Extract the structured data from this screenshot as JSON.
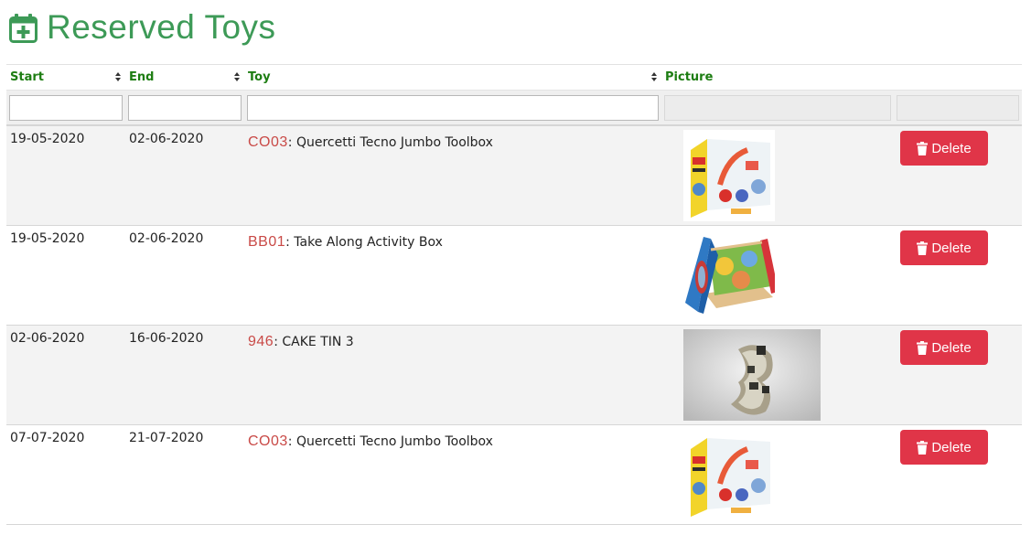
{
  "page": {
    "title": "Reserved Toys",
    "title_icon": "calendar-plus-icon",
    "accent_color": "#3d9a57"
  },
  "table": {
    "columns": [
      {
        "label": "Start",
        "sortable": true
      },
      {
        "label": "End",
        "sortable": true
      },
      {
        "label": "Toy",
        "sortable": true
      },
      {
        "label": "Picture",
        "sortable": false
      },
      {
        "label": "",
        "sortable": false
      }
    ],
    "filters": [
      {
        "value": "",
        "placeholder": "",
        "enabled": true
      },
      {
        "value": "",
        "placeholder": "",
        "enabled": true
      },
      {
        "value": "",
        "placeholder": "",
        "enabled": true
      },
      {
        "value": "",
        "placeholder": "",
        "enabled": false
      },
      {
        "value": "",
        "placeholder": "",
        "enabled": false
      }
    ],
    "rows": [
      {
        "start": "19-05-2020",
        "end": "02-06-2020",
        "code": "CO03",
        "name": ": Quercetti Tecno Jumbo Toolbox",
        "picture": "toy-box-image",
        "action": "Delete"
      },
      {
        "start": "19-05-2020",
        "end": "02-06-2020",
        "code": "BB01",
        "name": ": Take Along Activity Box",
        "picture": "activity-box-image",
        "action": "Delete"
      },
      {
        "start": "02-06-2020",
        "end": "16-06-2020",
        "code": "946",
        "name": ": CAKE TIN 3",
        "picture": "cake-tin-image",
        "action": "Delete"
      },
      {
        "start": "07-07-2020",
        "end": "21-07-2020",
        "code": "CO03",
        "name": ": Quercetti Tecno Jumbo Toolbox",
        "picture": "toy-box-image",
        "action": "Delete"
      }
    ],
    "delete_color": "#e03548",
    "code_color": "#c94a47",
    "header_color": "#1d7d12"
  }
}
